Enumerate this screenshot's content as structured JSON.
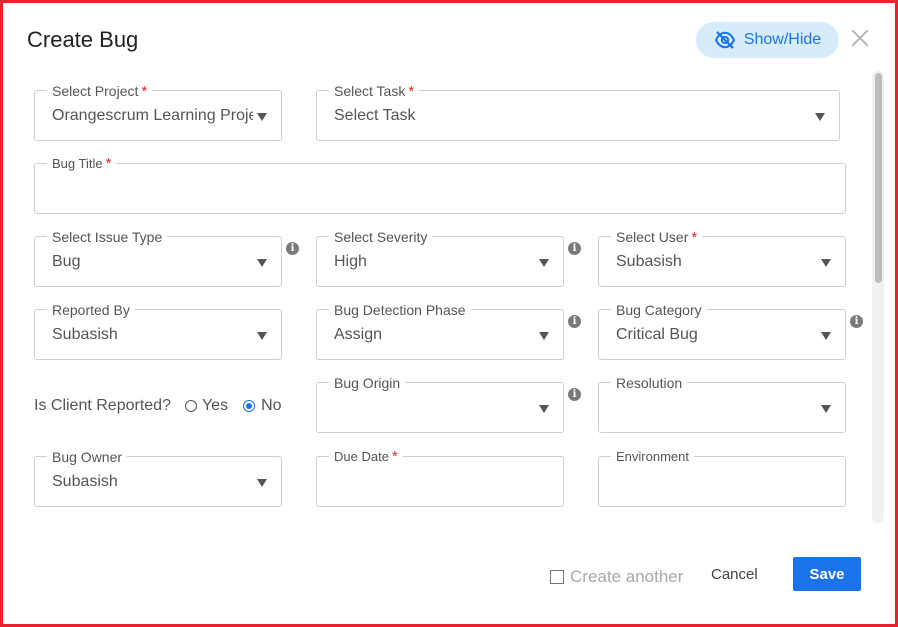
{
  "dialog": {
    "title": "Create Bug",
    "show_hide_label": "Show/Hide",
    "accent_color": "#1a73e8",
    "border_color": "#e8232d"
  },
  "fields": {
    "project": {
      "label": "Select Project",
      "required": "*",
      "value": "Orangescrum Learning Proje..."
    },
    "task": {
      "label": "Select Task",
      "required": "*",
      "value": "Select Task"
    },
    "bug_title": {
      "label": "Bug Title",
      "required": "*",
      "value": ""
    },
    "issue_type": {
      "label": "Select Issue Type",
      "value": "Bug"
    },
    "severity": {
      "label": "Select Severity",
      "value": "High"
    },
    "user": {
      "label": "Select User",
      "required": "*",
      "value": "Subasish"
    },
    "reported_by": {
      "label": "Reported By",
      "value": "Subasish"
    },
    "detection_phase": {
      "label": "Bug Detection Phase",
      "value": "Assign"
    },
    "category": {
      "label": "Bug Category",
      "value": "Critical Bug"
    },
    "origin": {
      "label": "Bug Origin",
      "value": ""
    },
    "resolution": {
      "label": "Resolution",
      "value": ""
    },
    "owner": {
      "label": "Bug Owner",
      "value": "Subasish"
    },
    "due_date": {
      "label": "Due Date",
      "required": "*",
      "value": ""
    },
    "environment": {
      "label": "Environment",
      "value": ""
    }
  },
  "client_reported": {
    "question": "Is Client Reported?",
    "yes_label": "Yes",
    "no_label": "No",
    "selected": "No"
  },
  "footer": {
    "create_another_label": "Create another",
    "cancel_label": "Cancel",
    "save_label": "Save"
  },
  "icons": [
    "eye-off-icon",
    "close-icon",
    "info-icon",
    "dropdown-caret-icon"
  ]
}
